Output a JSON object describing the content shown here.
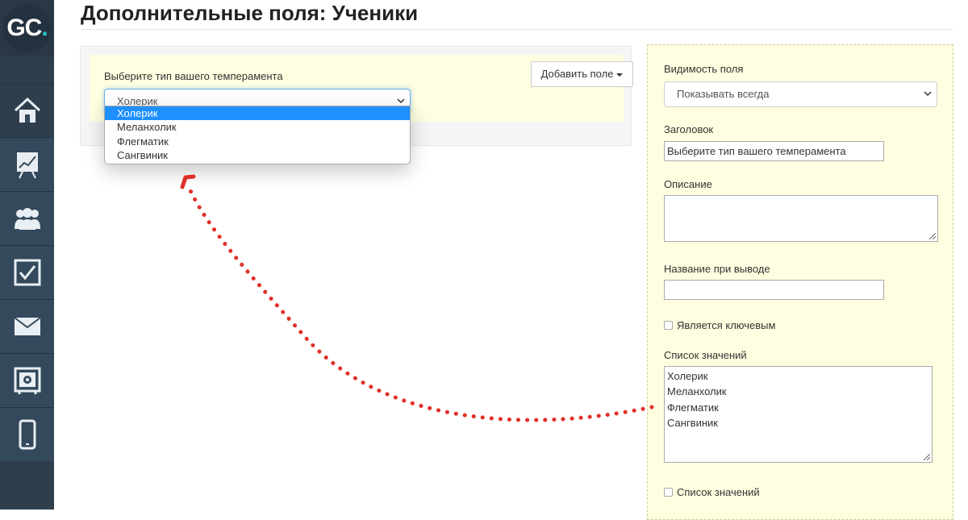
{
  "page": {
    "title": "Дополнительные поля: Ученики"
  },
  "sidebar": {
    "logo": {
      "text": "GC",
      "dot": "."
    },
    "items": [
      {
        "icon": "home-icon"
      },
      {
        "icon": "chart-board-icon"
      },
      {
        "icon": "users-icon"
      },
      {
        "icon": "checkbox-icon"
      },
      {
        "icon": "mail-icon"
      },
      {
        "icon": "safe-icon"
      },
      {
        "icon": "mobile-icon"
      }
    ]
  },
  "preview": {
    "field_label": "Выберите тип вашего темперамента",
    "selected_value": "Холерик",
    "add_field_label": "Добавить поле",
    "options": [
      "Холерик",
      "Меланхолик",
      "Флегматик",
      "Сангвиник"
    ]
  },
  "settings": {
    "visibility_label": "Видимость поля",
    "visibility_value": "Показывать всегда",
    "title_label": "Заголовок",
    "title_value": "Выберите тип вашего темперамента",
    "description_label": "Описание",
    "description_value": "",
    "output_name_label": "Название при выводе",
    "output_name_value": "",
    "key_checkbox_label": "Является ключевым",
    "values_list_label": "Список значений",
    "values_list": [
      "Холерик",
      "Меланхолик",
      "Флегматик",
      "Сангвиник"
    ],
    "values_checkbox_label": "Список значений"
  },
  "colors": {
    "sidebar": "#2f3e4d",
    "panel_yellow": "#fffee0",
    "selected_option": "#1e90ff",
    "annotation_arrow": "#e0302a"
  }
}
